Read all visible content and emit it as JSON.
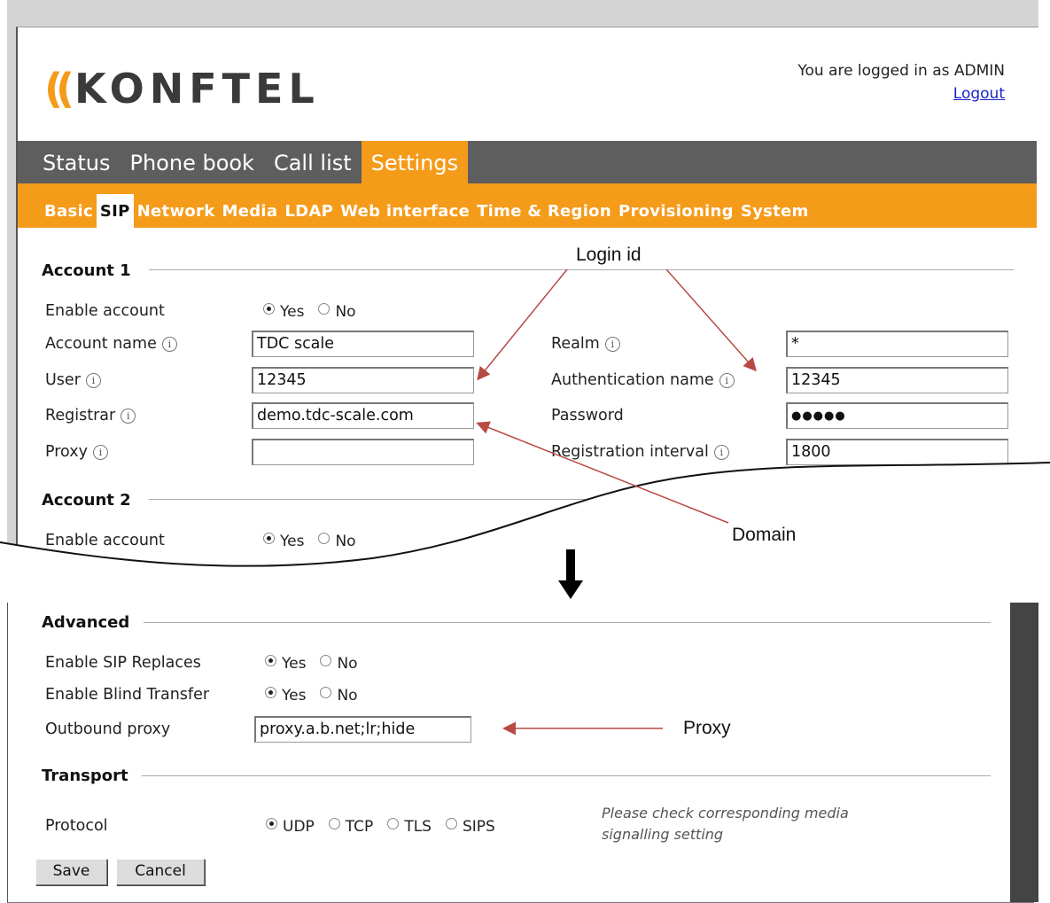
{
  "header": {
    "logo_text": "KONFTEL",
    "logo_waves": "((",
    "logged_in_text": "You are logged in as ADMIN",
    "logout_label": "Logout"
  },
  "main_nav": [
    {
      "label": "Status",
      "active": false
    },
    {
      "label": "Phone book",
      "active": false
    },
    {
      "label": "Call list",
      "active": false
    },
    {
      "label": "Settings",
      "active": true
    }
  ],
  "sub_nav": [
    {
      "label": "Basic",
      "active": false
    },
    {
      "label": "SIP",
      "active": true
    },
    {
      "label": "Network",
      "active": false
    },
    {
      "label": "Media",
      "active": false
    },
    {
      "label": "LDAP",
      "active": false
    },
    {
      "label": "Web interface",
      "active": false
    },
    {
      "label": "Time & Region",
      "active": false
    },
    {
      "label": "Provisioning",
      "active": false
    },
    {
      "label": "System",
      "active": false
    }
  ],
  "account1": {
    "title": "Account 1",
    "enable_label": "Enable account",
    "yes": "Yes",
    "no": "No",
    "account_name_label": "Account name",
    "account_name_value": "TDC scale",
    "user_label": "User",
    "user_value": "12345",
    "registrar_label": "Registrar",
    "registrar_value": "demo.tdc-scale.com",
    "proxy_label": "Proxy",
    "proxy_value": "",
    "realm_label": "Realm",
    "realm_value": "*",
    "auth_name_label": "Authentication name",
    "auth_name_value": "12345",
    "password_label": "Password",
    "password_value": "●●●●●",
    "reg_interval_label": "Registration interval",
    "reg_interval_value": "1800"
  },
  "account2": {
    "title": "Account 2",
    "enable_label": "Enable account",
    "yes": "Yes",
    "no": "No"
  },
  "advanced": {
    "title": "Advanced",
    "sip_replaces_label": "Enable SIP Replaces",
    "blind_transfer_label": "Enable Blind Transfer",
    "yes": "Yes",
    "no": "No",
    "outbound_proxy_label": "Outbound proxy",
    "outbound_proxy_value": "proxy.a.b.net;lr;hide"
  },
  "transport": {
    "title": "Transport",
    "protocol_label": "Protocol",
    "options": [
      "UDP",
      "TCP",
      "TLS",
      "SIPS"
    ],
    "selected": "UDP",
    "note_line1": "Please check corresponding media",
    "note_line2": "signalling setting"
  },
  "buttons": {
    "save": "Save",
    "cancel": "Cancel"
  },
  "annotations": {
    "login_id": "Login id",
    "domain": "Domain",
    "proxy": "Proxy"
  },
  "colors": {
    "accent_orange": "#f59b1a",
    "nav_gray": "#5e5e5e",
    "annotation_red": "#b84a44"
  }
}
